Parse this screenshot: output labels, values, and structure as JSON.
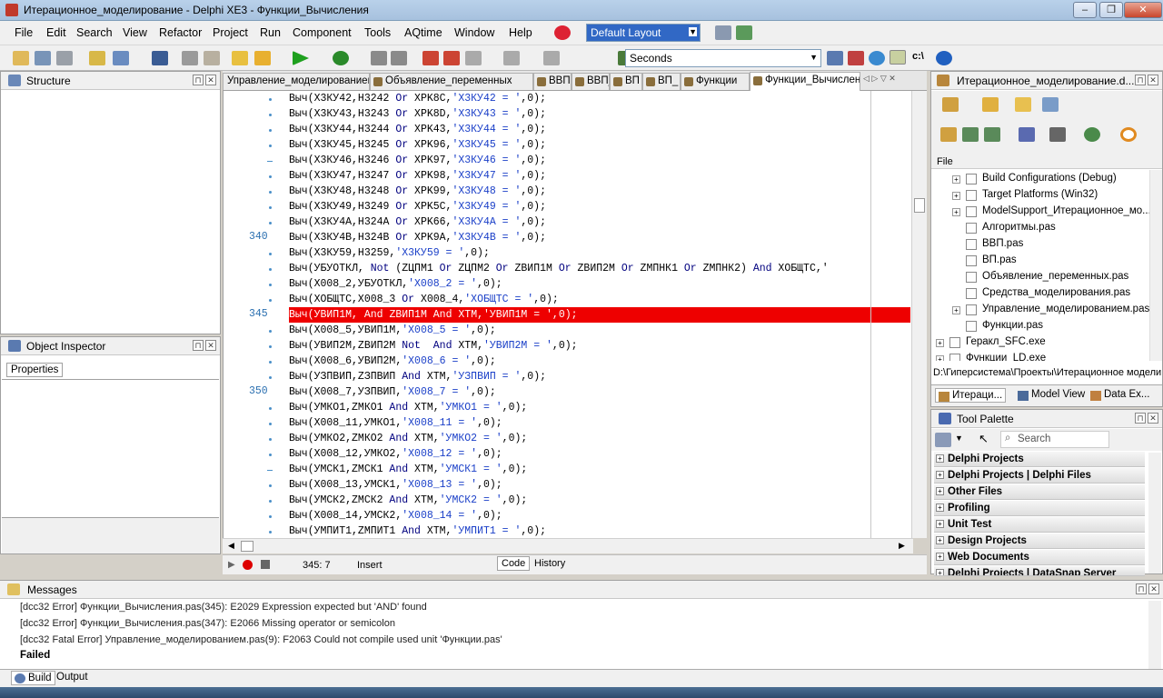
{
  "window": {
    "title": "Итерационное_моделирование - Delphi XE3 - Функции_Вычисления"
  },
  "menu": [
    "File",
    "Edit",
    "Search",
    "View",
    "Refactor",
    "Project",
    "Run",
    "Component",
    "Tools",
    "AQtime",
    "Window",
    "Help"
  ],
  "layout_combo": "Default Layout",
  "units_combo": "Seconds",
  "structure": {
    "title": "Structure"
  },
  "object_inspector": {
    "title": "Object Inspector",
    "tab": "Properties"
  },
  "tabs": [
    "Управление_моделированием",
    "Объявление_переменных",
    "ВВП",
    "ВВП_",
    "ВП",
    "ВП_",
    "Функции",
    "Функции_Вычисления"
  ],
  "editor": {
    "lines": [
      {
        "num": "",
        "mark": "dot",
        "code": [
          [
            "t",
            "Выч(X3КУ42,H3242 "
          ],
          [
            "k",
            "Or"
          ],
          [
            "t",
            " XPK8C,"
          ],
          [
            "s",
            "'X3КУ42 = '"
          ],
          [
            "t",
            ",0);"
          ]
        ]
      },
      {
        "num": "",
        "mark": "dot",
        "code": [
          [
            "t",
            "Выч(X3КУ43,H3243 "
          ],
          [
            "k",
            "Or"
          ],
          [
            "t",
            " XPK8D,"
          ],
          [
            "s",
            "'X3КУ43 = '"
          ],
          [
            "t",
            ",0);"
          ]
        ]
      },
      {
        "num": "",
        "mark": "dot",
        "code": [
          [
            "t",
            "Выч(X3КУ44,H3244 "
          ],
          [
            "k",
            "Or"
          ],
          [
            "t",
            " XPK43,"
          ],
          [
            "s",
            "'X3КУ44 = '"
          ],
          [
            "t",
            ",0);"
          ]
        ]
      },
      {
        "num": "",
        "mark": "dot",
        "code": [
          [
            "t",
            "Выч(X3КУ45,H3245 "
          ],
          [
            "k",
            "Or"
          ],
          [
            "t",
            " XPK96,"
          ],
          [
            "s",
            "'X3КУ45 = '"
          ],
          [
            "t",
            ",0);"
          ]
        ]
      },
      {
        "num": "",
        "mark": "dash",
        "code": [
          [
            "t",
            "Выч(X3КУ46,H3246 "
          ],
          [
            "k",
            "Or"
          ],
          [
            "t",
            " XPK97,"
          ],
          [
            "s",
            "'X3КУ46 = '"
          ],
          [
            "t",
            ",0);"
          ]
        ]
      },
      {
        "num": "",
        "mark": "dot",
        "code": [
          [
            "t",
            "Выч(X3КУ47,H3247 "
          ],
          [
            "k",
            "Or"
          ],
          [
            "t",
            " XPK98,"
          ],
          [
            "s",
            "'X3КУ47 = '"
          ],
          [
            "t",
            ",0);"
          ]
        ]
      },
      {
        "num": "",
        "mark": "dot",
        "code": [
          [
            "t",
            "Выч(X3КУ48,H3248 "
          ],
          [
            "k",
            "Or"
          ],
          [
            "t",
            " XPK99,"
          ],
          [
            "s",
            "'X3КУ48 = '"
          ],
          [
            "t",
            ",0);"
          ]
        ]
      },
      {
        "num": "",
        "mark": "dot",
        "code": [
          [
            "t",
            "Выч(X3КУ49,H3249 "
          ],
          [
            "k",
            "Or"
          ],
          [
            "t",
            " XPK5C,"
          ],
          [
            "s",
            "'X3КУ49 = '"
          ],
          [
            "t",
            ",0);"
          ]
        ]
      },
      {
        "num": "",
        "mark": "dot",
        "code": [
          [
            "t",
            "Выч(X3КУ4A,H324A "
          ],
          [
            "k",
            "Or"
          ],
          [
            "t",
            " XPK66,"
          ],
          [
            "s",
            "'X3КУ4A = '"
          ],
          [
            "t",
            ",0);"
          ]
        ]
      },
      {
        "num": "340",
        "mark": "",
        "code": [
          [
            "t",
            "Выч(X3КУ4B,H324B "
          ],
          [
            "k",
            "Or"
          ],
          [
            "t",
            " XPK9A,"
          ],
          [
            "s",
            "'X3КУ4B = '"
          ],
          [
            "t",
            ",0);"
          ]
        ]
      },
      {
        "num": "",
        "mark": "dot",
        "code": [
          [
            "t",
            "Выч(X3КУ59,H3259,"
          ],
          [
            "s",
            "'X3КУ59 = '"
          ],
          [
            "t",
            ",0);"
          ]
        ]
      },
      {
        "num": "",
        "mark": "dot",
        "code": [
          [
            "t",
            "Выч(УБУОТКЛ, "
          ],
          [
            "k",
            "Not"
          ],
          [
            "t",
            " (ZЦПМ1 "
          ],
          [
            "k",
            "Or"
          ],
          [
            "t",
            " ZЦПМ2 "
          ],
          [
            "k",
            "Or"
          ],
          [
            "t",
            " ZВИП1М "
          ],
          [
            "k",
            "Or"
          ],
          [
            "t",
            " ZВИП2М "
          ],
          [
            "k",
            "Or"
          ],
          [
            "t",
            " ZМПНК1 "
          ],
          [
            "k",
            "Or"
          ],
          [
            "t",
            " ZМПНК2) "
          ],
          [
            "k",
            "And"
          ],
          [
            "t",
            " XОБЩТС,'"
          ]
        ]
      },
      {
        "num": "",
        "mark": "dot",
        "code": [
          [
            "t",
            "Выч(X008_2,УБУОТКЛ,"
          ],
          [
            "s",
            "'X008_2 = '"
          ],
          [
            "t",
            ",0);"
          ]
        ]
      },
      {
        "num": "",
        "mark": "dot",
        "code": [
          [
            "t",
            "Выч(XОБЩТС,X008_3 "
          ],
          [
            "k",
            "Or"
          ],
          [
            "t",
            " X008_4,"
          ],
          [
            "s",
            "'XОБЩТС = '"
          ],
          [
            "t",
            ",0);"
          ]
        ]
      },
      {
        "num": "345",
        "mark": "",
        "err": true,
        "code": [
          [
            "t",
            "Выч(УВИП1М, "
          ],
          [
            "k",
            "And"
          ],
          [
            "t",
            " ZВИП1М "
          ],
          [
            "k",
            "And"
          ],
          [
            "t",
            " XТМ,"
          ],
          [
            "s",
            "'УВИП1М = '"
          ],
          [
            "t",
            ",0);"
          ]
        ]
      },
      {
        "num": "",
        "mark": "dot",
        "code": [
          [
            "t",
            "Выч(X008_5,УВИП1М,"
          ],
          [
            "s",
            "'X008_5 = '"
          ],
          [
            "t",
            ",0);"
          ]
        ]
      },
      {
        "num": "",
        "mark": "dot",
        "code": [
          [
            "t",
            "Выч(УВИП2М,ZВИП2М "
          ],
          [
            "k",
            "Not"
          ],
          [
            "t",
            "  "
          ],
          [
            "k",
            "And"
          ],
          [
            "t",
            " XТМ,"
          ],
          [
            "s",
            "'УВИП2М = '"
          ],
          [
            "t",
            ",0);"
          ]
        ]
      },
      {
        "num": "",
        "mark": "dot",
        "code": [
          [
            "t",
            "Выч(X008_6,УВИП2М,"
          ],
          [
            "s",
            "'X008_6 = '"
          ],
          [
            "t",
            ",0);"
          ]
        ]
      },
      {
        "num": "",
        "mark": "dot",
        "code": [
          [
            "t",
            "Выч(УЗПВИП,ZЗПВИП "
          ],
          [
            "k",
            "And"
          ],
          [
            "t",
            " XТМ,"
          ],
          [
            "s",
            "'УЗПВИП = '"
          ],
          [
            "t",
            ",0);"
          ]
        ]
      },
      {
        "num": "350",
        "mark": "",
        "code": [
          [
            "t",
            "Выч(X008_7,УЗПВИП,"
          ],
          [
            "s",
            "'X008_7 = '"
          ],
          [
            "t",
            ",0);"
          ]
        ]
      },
      {
        "num": "",
        "mark": "dot",
        "code": [
          [
            "t",
            "Выч(УМКО1,ZМКО1 "
          ],
          [
            "k",
            "And"
          ],
          [
            "t",
            " XТМ,"
          ],
          [
            "s",
            "'УМКО1 = '"
          ],
          [
            "t",
            ",0);"
          ]
        ]
      },
      {
        "num": "",
        "mark": "dot",
        "code": [
          [
            "t",
            "Выч(X008_11,УМКО1,"
          ],
          [
            "s",
            "'X008_11 = '"
          ],
          [
            "t",
            ",0);"
          ]
        ]
      },
      {
        "num": "",
        "mark": "dot",
        "code": [
          [
            "t",
            "Выч(УМКО2,ZМКО2 "
          ],
          [
            "k",
            "And"
          ],
          [
            "t",
            " XТМ,"
          ],
          [
            "s",
            "'УМКО2 = '"
          ],
          [
            "t",
            ",0);"
          ]
        ]
      },
      {
        "num": "",
        "mark": "dot",
        "code": [
          [
            "t",
            "Выч(X008_12,УМКО2,"
          ],
          [
            "s",
            "'X008_12 = '"
          ],
          [
            "t",
            ",0);"
          ]
        ]
      },
      {
        "num": "",
        "mark": "dash",
        "code": [
          [
            "t",
            "Выч(УМСК1,ZМСК1 "
          ],
          [
            "k",
            "And"
          ],
          [
            "t",
            " XТМ,"
          ],
          [
            "s",
            "'УМСК1 = '"
          ],
          [
            "t",
            ",0);"
          ]
        ]
      },
      {
        "num": "",
        "mark": "dot",
        "code": [
          [
            "t",
            "Выч(X008_13,УМСК1,"
          ],
          [
            "s",
            "'X008_13 = '"
          ],
          [
            "t",
            ",0);"
          ]
        ]
      },
      {
        "num": "",
        "mark": "dot",
        "code": [
          [
            "t",
            "Выч(УМСК2,ZМСК2 "
          ],
          [
            "k",
            "And"
          ],
          [
            "t",
            " XТМ,"
          ],
          [
            "s",
            "'УМСК2 = '"
          ],
          [
            "t",
            ",0);"
          ]
        ]
      },
      {
        "num": "",
        "mark": "dot",
        "code": [
          [
            "t",
            "Выч(X008_14,УМСК2,"
          ],
          [
            "s",
            "'X008_14 = '"
          ],
          [
            "t",
            ",0);"
          ]
        ]
      },
      {
        "num": "",
        "mark": "dot",
        "code": [
          [
            "t",
            "Выч(УМПИТ1,ZМПИТ1 "
          ],
          [
            "k",
            "And"
          ],
          [
            "t",
            " XТМ,"
          ],
          [
            "s",
            "'УМПИТ1 = '"
          ],
          [
            "t",
            ",0);"
          ]
        ]
      }
    ],
    "status": {
      "position": "345:  7",
      "mode": "Insert"
    },
    "bottom_tabs": [
      "Code",
      "History"
    ]
  },
  "project": {
    "title": "Итерационное_моделирование.d...",
    "column": "File",
    "items": [
      {
        "label": "Build Configurations (Debug)",
        "exp": "+",
        "depth": 1
      },
      {
        "label": "Target Platforms (Win32)",
        "exp": "+",
        "depth": 1
      },
      {
        "label": "ModelSupport_Итерационное_мо...",
        "exp": "+",
        "depth": 1
      },
      {
        "label": "Алгоритмы.pas",
        "exp": "",
        "depth": 1
      },
      {
        "label": "ВВП.pas",
        "exp": "",
        "depth": 1
      },
      {
        "label": "ВП.pas",
        "exp": "",
        "depth": 1
      },
      {
        "label": "Объявление_переменных.pas",
        "exp": "",
        "depth": 1
      },
      {
        "label": "Средства_моделирования.pas",
        "exp": "",
        "depth": 1
      },
      {
        "label": "Управление_моделированием.pas",
        "exp": "+",
        "depth": 1
      },
      {
        "label": "Функции.pas",
        "exp": "",
        "depth": 1
      },
      {
        "label": "Геракл_SFC.exe",
        "exp": "+",
        "depth": 0
      },
      {
        "label": "Функции_LD.exe",
        "exp": "+",
        "depth": 0
      }
    ],
    "path": "D:\\Гиперсистема\\Проекты\\Итерационное моделир",
    "tabs": [
      "Итераци...",
      "Model View",
      "Data Ex..."
    ]
  },
  "palette": {
    "title": "Tool Palette",
    "search_placeholder": "Search",
    "categories": [
      "Delphi Projects",
      "Delphi Projects | Delphi Files",
      "Other Files",
      "Profiling",
      "Unit Test",
      "Design Projects",
      "Web Documents",
      "Delphi Projects | DataSnap Server"
    ]
  },
  "messages": {
    "title": "Messages",
    "lines": [
      "[dcc32 Error] Функции_Вычисления.pas(345): E2029 Expression expected but 'AND' found",
      "[dcc32 Error] Функции_Вычисления.pas(347): E2066 Missing operator or semicolon",
      "[dcc32 Fatal Error] Управление_моделированием.pas(9): F2063 Could not compile used unit 'Функции.pas'"
    ],
    "result": "Failed",
    "tabs": [
      "Build",
      "Output"
    ]
  }
}
